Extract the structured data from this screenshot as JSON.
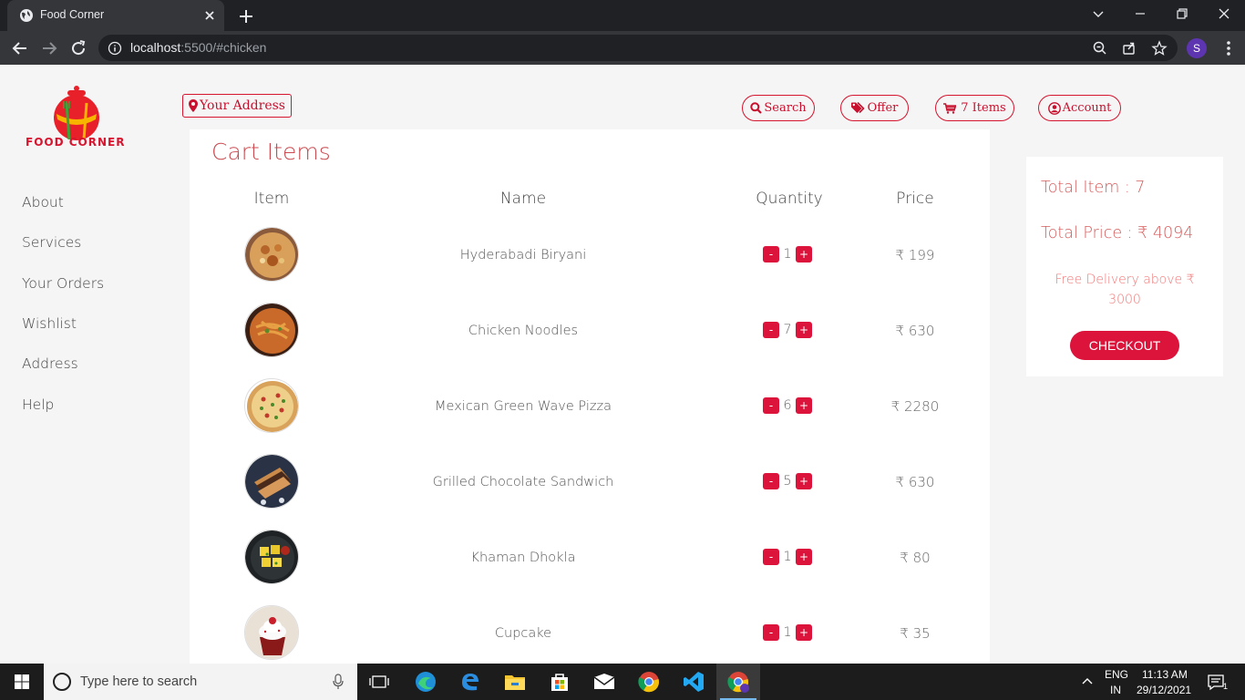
{
  "browser": {
    "tab_title": "Food Corner",
    "url_host": "localhost",
    "url_rest": ":5500/#chicken",
    "profile_initial": "S"
  },
  "header": {
    "logo_text": "FOOD CORNER",
    "address_label": "Your Address",
    "search_label": "Search",
    "offer_label": "Offer",
    "cart_label": "7 Items",
    "account_label": "Account"
  },
  "sidebar": {
    "items": [
      {
        "label": "About"
      },
      {
        "label": "Services"
      },
      {
        "label": "Your Orders"
      },
      {
        "label": "Wishlist"
      },
      {
        "label": "Address"
      },
      {
        "label": "Help"
      }
    ]
  },
  "cart": {
    "title": "Cart Items",
    "columns": {
      "item": "Item",
      "name": "Name",
      "quantity": "Quantity",
      "price": "Price"
    },
    "minus": "-",
    "plus": "+",
    "rows": [
      {
        "name": "Hyderabadi Biryani",
        "qty": "1",
        "price": "₹ 199",
        "image": "biryani"
      },
      {
        "name": "Chicken Noodles",
        "qty": "7",
        "price": "₹ 630",
        "image": "noodles"
      },
      {
        "name": "Mexican Green Wave Pizza",
        "qty": "6",
        "price": "₹ 2280",
        "image": "pizza"
      },
      {
        "name": "Grilled Chocolate Sandwich",
        "qty": "5",
        "price": "₹ 630",
        "image": "sandwich"
      },
      {
        "name": "Khaman Dhokla",
        "qty": "1",
        "price": "₹ 80",
        "image": "dhokla"
      },
      {
        "name": "Cupcake",
        "qty": "1",
        "price": "₹ 35",
        "image": "cupcake"
      }
    ]
  },
  "summary": {
    "total_items": "Total Item : 7",
    "total_price": "Total Price : ₹ 4094",
    "free_delivery": "Free Delivery above ₹ 3000",
    "checkout_label": "CHECKOUT"
  },
  "taskbar": {
    "search_placeholder": "Type here to search",
    "lang_top": "ENG",
    "lang_bottom": "IN",
    "time": "11:13 AM",
    "date": "29/12/2021",
    "notification_count": "1"
  },
  "colors": {
    "accent": "#dc143c",
    "title": "#c94a50",
    "summary_text": "#d65c5c"
  }
}
